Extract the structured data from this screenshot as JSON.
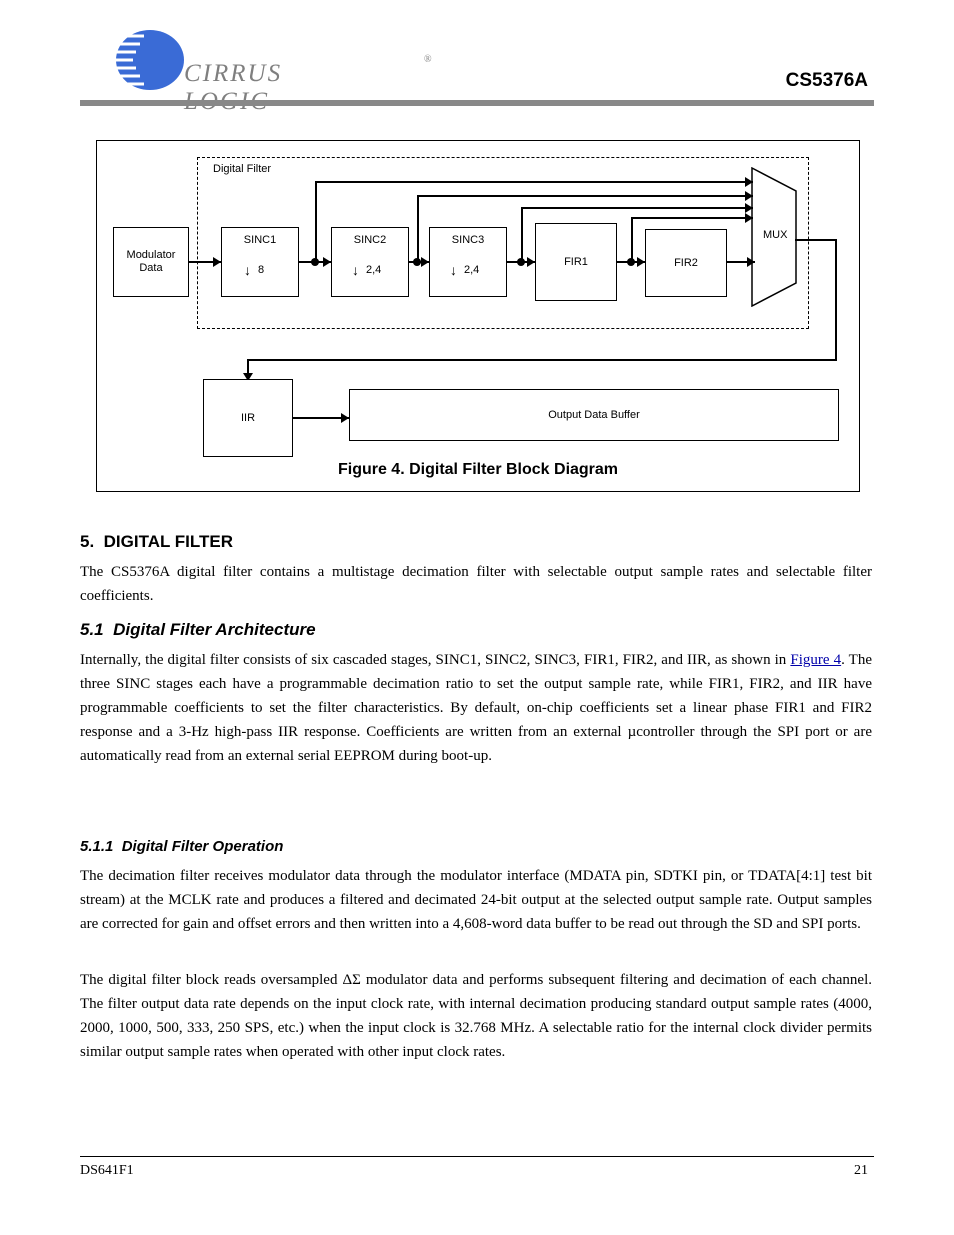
{
  "logo": {
    "brand": "CIRRUS LOGIC",
    "reg": "®"
  },
  "docnum": "CS5376A",
  "figure": {
    "caption": "Figure 4. Digital Filter Block Diagram",
    "dashed_label": "Digital Filter",
    "blocks": {
      "modulator": "Modulator\nData",
      "sinc1": "SINC1",
      "sinc2": "SINC2",
      "sinc3": "SINC3",
      "fir1": "FIR1",
      "fir2": "FIR2",
      "iir": "IIR",
      "buffer": "Output Data Buffer"
    },
    "decimate": {
      "s1": "8",
      "s2": "2,4",
      "s3": "2,4"
    }
  },
  "sections": {
    "s1": {
      "num": "5.",
      "title": "DIGITAL FILTER"
    },
    "s11": {
      "num": "5.1",
      "title": "Digital Filter Architecture"
    },
    "s111": {
      "num": "5.1.1",
      "title": "Digital Filter Operation"
    }
  },
  "para": {
    "p1": "The CS5376A digital filter contains a multistage decimation filter with selectable output sample rates and selectable filter coefficients.",
    "p2_a": "The digital filter block reads oversampled ",
    "p2_b": " modulator data and performs subsequent filtering and decimation of each channel. The filter output data rate depends on the input clock rate, with internal decimation producing standard output sample rates (4000, 2000, 1000, 500, 333, 250 SPS, etc.) when the input clock is 32.768 MHz. A selectable ratio for the internal clock divider permits similar output sample rates when operated with other input clock rates.",
    "ds": "ΔΣ",
    "p3_a": "Internally, the digital filter consists of six cascaded stages, SINC1, SINC2, SINC3, FIR1, FIR2, and IIR, as shown in ",
    "p3_ref": "Figure 4",
    "p3_b": ". The three SINC stages each have a programmable decimation ratio to set the output sample rate, while FIR1, FIR2, and IIR have programmable coefficients to set the filter characteristics. By default, on-chip coefficients set a linear phase FIR1 and FIR2 response and a 3-Hz high-pass IIR response. Coefficients are written from an external ",
    "p3_c": "controller through the SPI port or are automatically read from an external serial EEPROM during boot-up.",
    "mu": "µ"
  },
  "footer": {
    "left": "DS641F1",
    "page": "21"
  }
}
